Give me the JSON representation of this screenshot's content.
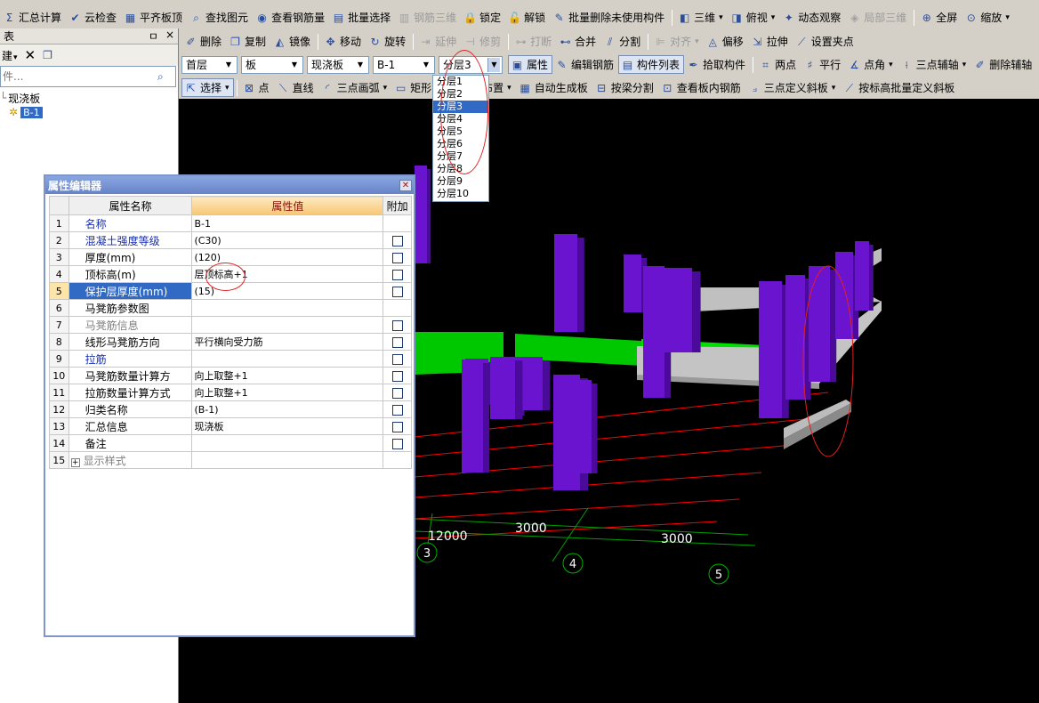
{
  "colors": {
    "accent": "#316ac5",
    "circle": "#e02020",
    "column": "#6a14d0",
    "beam": "#00c800",
    "slab": "#c0c0c0",
    "axis_line": "#ff0000",
    "dim_line": "#00a000"
  },
  "toolbar1": [
    {
      "icon": "summary-icon",
      "glyph": "Σ",
      "label": "汇总计算"
    },
    {
      "icon": "cloud-check-icon",
      "glyph": "✔",
      "label": "云检查"
    },
    {
      "icon": "align-slab-icon",
      "glyph": "▦",
      "label": "平齐板顶"
    },
    {
      "icon": "find-element-icon",
      "glyph": "⌕",
      "label": "查找图元"
    },
    {
      "icon": "view-rebar-icon",
      "glyph": "◉",
      "label": "查看钢筋量"
    },
    {
      "icon": "batch-select-icon",
      "glyph": "▤",
      "label": "批量选择"
    },
    {
      "icon": "rebar-3d-icon",
      "glyph": "▥",
      "label": "钢筋三维",
      "disabled": true
    },
    {
      "icon": "lock-icon",
      "glyph": "🔒",
      "label": "锁定"
    },
    {
      "icon": "unlock-icon",
      "glyph": "🔓",
      "label": "解锁"
    },
    {
      "icon": "batch-delete-icon",
      "glyph": "✎",
      "label": "批量删除未使用构件"
    },
    {
      "icon": "3d-icon",
      "glyph": "◧",
      "label": "三维",
      "dropdown": true
    },
    {
      "icon": "top-view-icon",
      "glyph": "◨",
      "label": "俯视",
      "dropdown": true
    },
    {
      "icon": "orbit-icon",
      "glyph": "✦",
      "label": "动态观察"
    },
    {
      "icon": "local-3d-icon",
      "glyph": "◈",
      "label": "局部三维",
      "disabled": true
    },
    {
      "icon": "fullscreen-icon",
      "glyph": "⊕",
      "label": "全屏"
    },
    {
      "icon": "zoom-icon",
      "glyph": "⊙",
      "label": "缩放",
      "dropdown": true
    }
  ],
  "toolbar2": [
    {
      "icon": "delete-icon",
      "glyph": "✐",
      "label": "删除"
    },
    {
      "icon": "copy-icon",
      "glyph": "❐",
      "label": "复制"
    },
    {
      "icon": "mirror-icon",
      "glyph": "◭",
      "label": "镜像"
    },
    {
      "icon": "move-icon",
      "glyph": "✥",
      "label": "移动"
    },
    {
      "icon": "rotate-icon",
      "glyph": "↻",
      "label": "旋转"
    },
    {
      "icon": "extend-icon",
      "glyph": "⇥",
      "label": "延伸",
      "disabled": true
    },
    {
      "icon": "trim-icon",
      "glyph": "⊣",
      "label": "修剪",
      "disabled": true
    },
    {
      "icon": "break-icon",
      "glyph": "⊶",
      "label": "打断",
      "disabled": true
    },
    {
      "icon": "merge-icon",
      "glyph": "⊷",
      "label": "合并"
    },
    {
      "icon": "split-icon",
      "glyph": "⫽",
      "label": "分割"
    },
    {
      "icon": "align-icon",
      "glyph": "⊫",
      "label": "对齐",
      "disabled": true,
      "dropdown": true
    },
    {
      "icon": "offset-icon",
      "glyph": "◬",
      "label": "偏移"
    },
    {
      "icon": "stretch-icon",
      "glyph": "⇲",
      "label": "拉伸"
    },
    {
      "icon": "set-grip-icon",
      "glyph": "⟋",
      "label": "设置夹点"
    }
  ],
  "toolbar3": {
    "floor": "首层",
    "category": "板",
    "type": "现浇板",
    "element": "B-1",
    "layer": "分层3",
    "buttons": [
      {
        "icon": "properties-icon",
        "glyph": "▣",
        "label": "属性",
        "active": true
      },
      {
        "icon": "edit-rebar-icon",
        "glyph": "✎",
        "label": "编辑钢筋"
      },
      {
        "icon": "element-list-icon",
        "glyph": "▤",
        "label": "构件列表",
        "active": true
      },
      {
        "icon": "pick-element-icon",
        "glyph": "✒",
        "label": "拾取构件"
      },
      {
        "icon": "two-point-icon",
        "glyph": "⌗",
        "label": "两点"
      },
      {
        "icon": "parallel-icon",
        "glyph": "♯",
        "label": "平行"
      },
      {
        "icon": "point-angle-icon",
        "glyph": "∡",
        "label": "点角",
        "dropdown": true
      },
      {
        "icon": "three-point-axis-icon",
        "glyph": "⟊",
        "label": "三点辅轴",
        "dropdown": true
      },
      {
        "icon": "delete-axis-icon",
        "glyph": "✐",
        "label": "删除辅轴"
      }
    ]
  },
  "toolbar4": [
    {
      "icon": "select-icon",
      "glyph": "⇱",
      "label": "选择",
      "dropdown": true,
      "active": true
    },
    {
      "icon": "point-icon",
      "glyph": "⊠",
      "label": "点"
    },
    {
      "icon": "line-icon",
      "glyph": "⟍",
      "label": "直线"
    },
    {
      "icon": "arc-icon",
      "glyph": "◜",
      "label": "三点画弧",
      "dropdown": true
    },
    {
      "icon": "rect-icon",
      "glyph": "▭",
      "label": "矩形"
    },
    {
      "icon": "smart-layout-icon",
      "glyph": "⊞",
      "label": "智能布置",
      "dropdown": true
    },
    {
      "icon": "auto-slab-icon",
      "glyph": "▦",
      "label": "自动生成板"
    },
    {
      "icon": "beam-split-icon",
      "glyph": "⊟",
      "label": "按梁分割"
    },
    {
      "icon": "view-slab-rebar-icon",
      "glyph": "⊡",
      "label": "查看板内钢筋"
    },
    {
      "icon": "3pt-slope-icon",
      "glyph": "⟓",
      "label": "三点定义斜板",
      "dropdown": true
    },
    {
      "icon": "batch-slope-icon",
      "glyph": "⟋",
      "label": "按标高批量定义斜板"
    }
  ],
  "layers": [
    "分层1",
    "分层2",
    "分层3",
    "分层4",
    "分层5",
    "分层6",
    "分层7",
    "分层8",
    "分层9",
    "分层10"
  ],
  "left_panel": {
    "header_label": "表",
    "pin": "ㅁ",
    "close": "×",
    "new_label": "建",
    "search_placeholder": "件...",
    "tree_root": "现浇板",
    "tree_child": "B-1"
  },
  "prop_editor": {
    "title": "属性编辑器",
    "col_name": "属性名称",
    "col_value": "属性值",
    "col_extra": "附加",
    "rows": [
      {
        "n": "1",
        "name": "名称",
        "value": "B-1",
        "style": "blue",
        "check": false
      },
      {
        "n": "2",
        "name": "混凝土强度等级",
        "value": "(C30)",
        "style": "blue",
        "check": true
      },
      {
        "n": "3",
        "name": "厚度(mm)",
        "value": "(120)",
        "style": "",
        "check": true
      },
      {
        "n": "4",
        "name": "顶标高(m)",
        "value": "层顶标高+1",
        "style": "",
        "check": true
      },
      {
        "n": "5",
        "name": "保护层厚度(mm)",
        "value": "(15)",
        "style": "sel",
        "check": true
      },
      {
        "n": "6",
        "name": "马凳筋参数图",
        "value": "",
        "style": "",
        "check": false
      },
      {
        "n": "7",
        "name": "马凳筋信息",
        "value": "",
        "style": "gray",
        "check": true
      },
      {
        "n": "8",
        "name": "线形马凳筋方向",
        "value": "平行横向受力筋",
        "style": "",
        "check": true
      },
      {
        "n": "9",
        "name": "拉筋",
        "value": "",
        "style": "blue",
        "check": true
      },
      {
        "n": "10",
        "name": "马凳筋数量计算方",
        "value": "向上取整+1",
        "style": "",
        "check": true
      },
      {
        "n": "11",
        "name": "拉筋数量计算方式",
        "value": "向上取整+1",
        "style": "",
        "check": true
      },
      {
        "n": "12",
        "name": "归类名称",
        "value": "(B-1)",
        "style": "",
        "check": true
      },
      {
        "n": "13",
        "name": "汇总信息",
        "value": "现浇板",
        "style": "",
        "check": true
      },
      {
        "n": "14",
        "name": "备注",
        "value": "",
        "style": "",
        "check": true
      },
      {
        "n": "15",
        "name": "显示样式",
        "value": "",
        "style": "gray",
        "check": false,
        "expand": true
      }
    ]
  },
  "viewport": {
    "dims": [
      "12000",
      "3000",
      "3000"
    ],
    "axes": [
      "3",
      "4",
      "5"
    ]
  }
}
